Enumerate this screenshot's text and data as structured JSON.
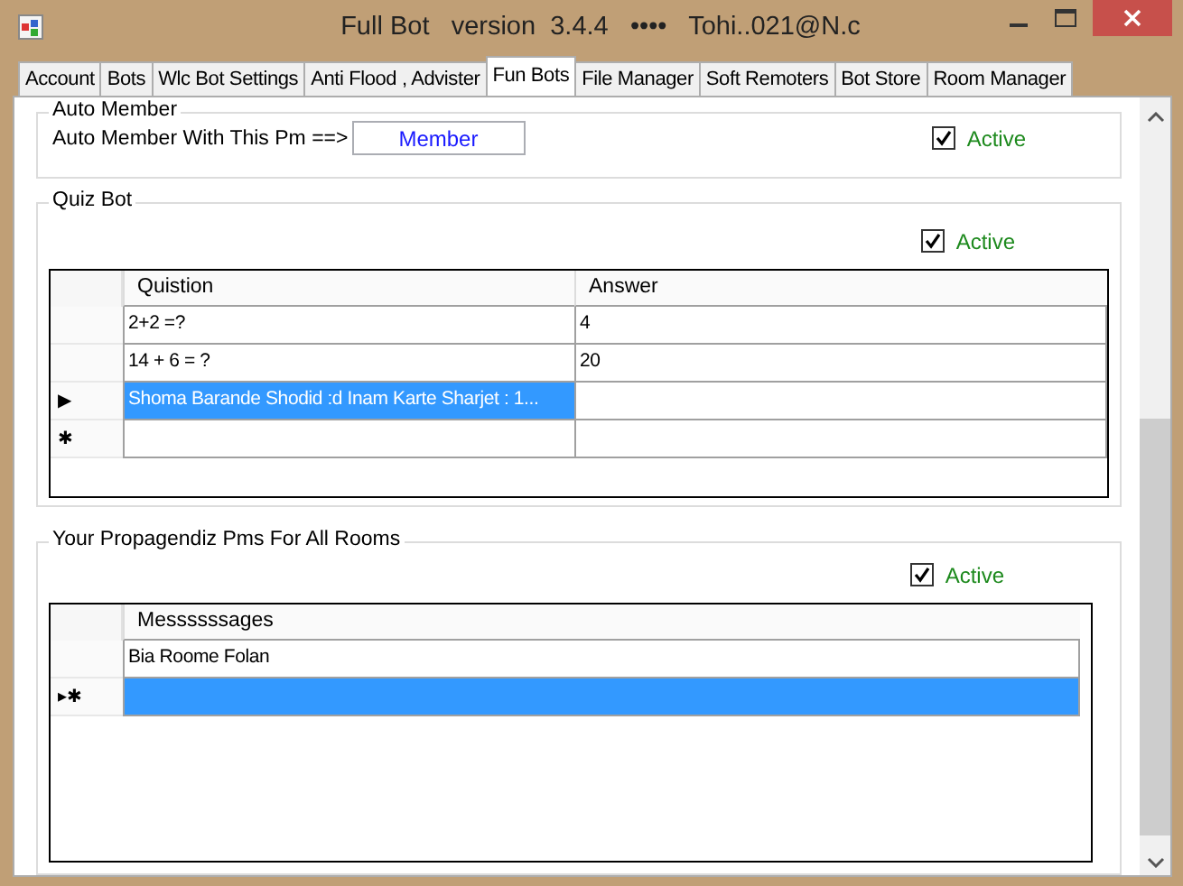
{
  "window": {
    "title": "Full Bot   version  3.4.4   ••••   Tohi..021@N.c"
  },
  "tabs": [
    {
      "label": "Account",
      "selected": false
    },
    {
      "label": "Bots",
      "selected": false
    },
    {
      "label": "Wlc Bot Settings",
      "selected": false
    },
    {
      "label": "Anti Flood , Advister",
      "selected": false
    },
    {
      "label": "Fun Bots",
      "selected": true
    },
    {
      "label": "File Manager",
      "selected": false
    },
    {
      "label": "Soft Remoters",
      "selected": false
    },
    {
      "label": "Bot Store",
      "selected": false
    },
    {
      "label": "Room Manager",
      "selected": false
    }
  ],
  "auto_member": {
    "legend": "Auto Member",
    "label": "Auto Member With This Pm ==>",
    "value": "Member",
    "active": {
      "label": "Active",
      "checked": true
    }
  },
  "quiz_bot": {
    "legend": "Quiz Bot",
    "active": {
      "label": "Active",
      "checked": true
    },
    "grid": {
      "columns": [
        "Quistion",
        "Answer"
      ],
      "rows": [
        {
          "marker": "",
          "cells": [
            "2+2 =?",
            "4"
          ],
          "selected": false
        },
        {
          "marker": "",
          "cells": [
            "14 + 6 = ?",
            "20"
          ],
          "selected": false
        },
        {
          "marker": "▶",
          "cells": [
            "Shoma Barande Shodid :d Inam Karte Sharjet : 1...",
            ""
          ],
          "selected": true
        },
        {
          "marker": "✱",
          "cells": [
            "",
            ""
          ],
          "selected": false
        }
      ]
    }
  },
  "propaganda": {
    "legend": "Your Propagendiz Pms For All Rooms",
    "active": {
      "label": "Active",
      "checked": true
    },
    "grid": {
      "columns": [
        "Messssssages"
      ],
      "rows": [
        {
          "marker": "",
          "cells": [
            "Bia Roome Folan"
          ],
          "selected": false
        },
        {
          "marker": "▸✱",
          "cells": [
            ""
          ],
          "selected": true
        }
      ]
    }
  }
}
